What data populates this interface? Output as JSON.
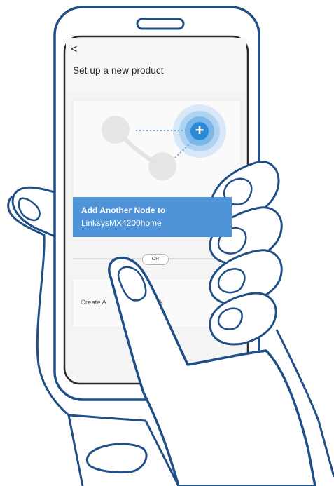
{
  "screen": {
    "back_glyph": "<",
    "title": "Set up a new product",
    "add_node_line1": "Add Another Node to",
    "add_node_line2": "LinksysMX4200home",
    "or_label": "OR",
    "create_label_visible": "Create A",
    "create_label_tail": "k"
  },
  "icons": {
    "plus": "+",
    "back": "chevron-left-icon"
  },
  "colors": {
    "outline": "#1f4f86",
    "accent": "#4f93d9",
    "plus_button": "#2b8ad6",
    "glow": "#8fc3ee"
  }
}
